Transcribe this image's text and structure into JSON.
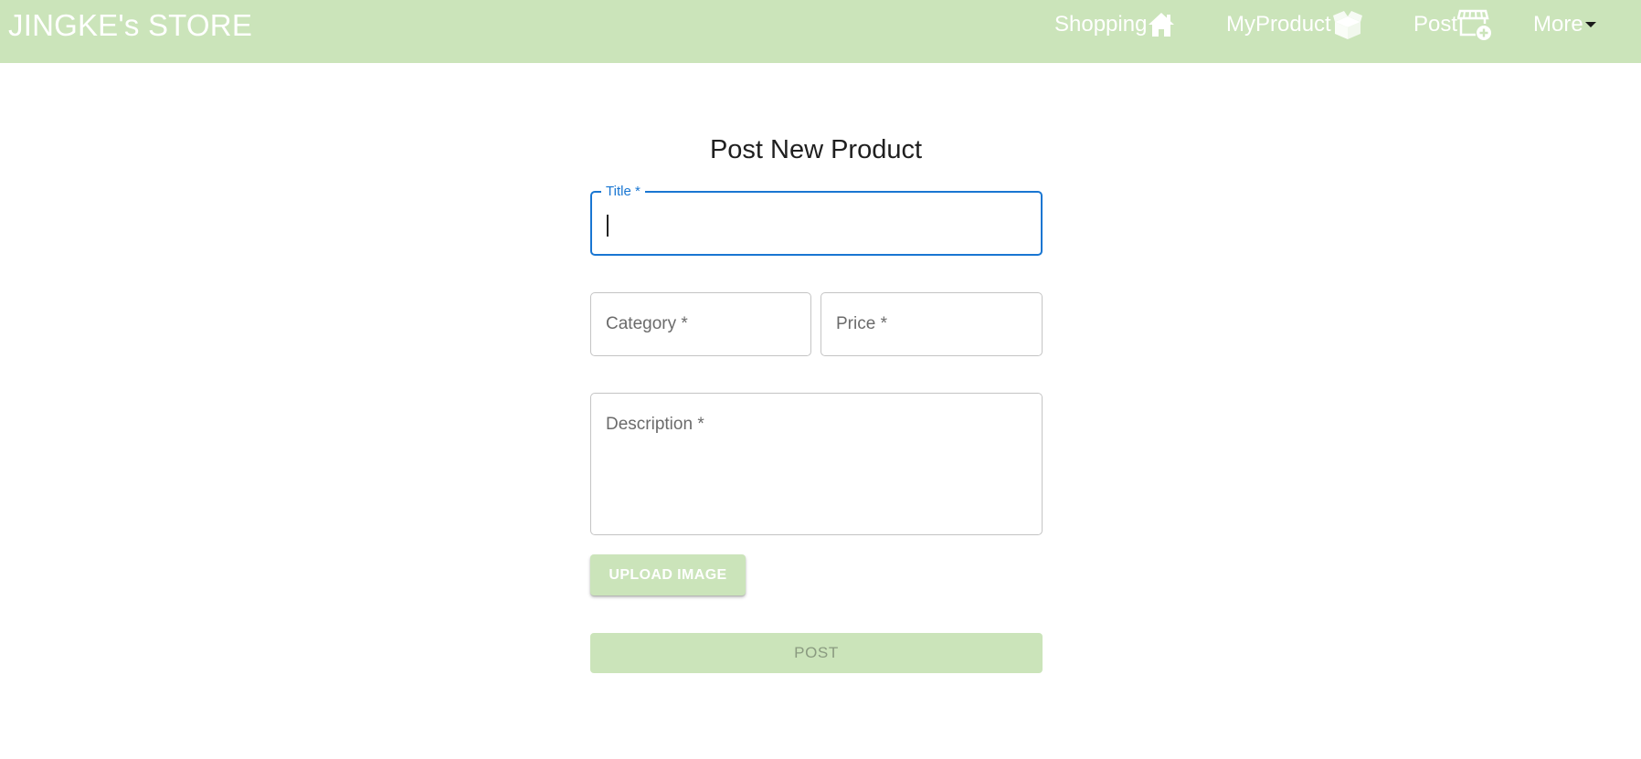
{
  "navbar": {
    "brand": "JINGKE's STORE",
    "items": [
      {
        "label": "Shopping",
        "icon": "home-icon"
      },
      {
        "label": "MyProduct",
        "icon": "box-icon"
      },
      {
        "label": "Post",
        "icon": "storefront-add-icon"
      },
      {
        "label": "More",
        "icon": "caret-down-icon"
      }
    ]
  },
  "form": {
    "heading": "Post New Product",
    "title_label": "Title *",
    "title_value": "",
    "category_label": "Category *",
    "price_label": "Price *",
    "description_label": "Description *",
    "upload_label": "UPLOAD IMAGE",
    "post_label": "POST"
  },
  "colors": {
    "navbar_bg": "#cbe4ba",
    "focus": "#1976d2",
    "button_bg": "#cbe4ba"
  }
}
